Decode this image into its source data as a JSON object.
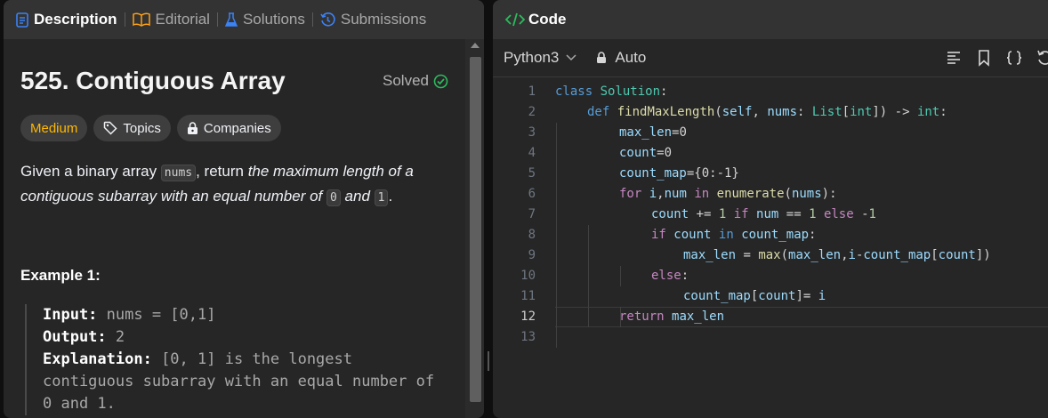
{
  "left_panel": {
    "tabs": [
      {
        "label": "Description",
        "icon": "document-icon"
      },
      {
        "label": "Editorial",
        "icon": "book-icon"
      },
      {
        "label": "Solutions",
        "icon": "flask-icon"
      },
      {
        "label": "Submissions",
        "icon": "history-icon"
      }
    ],
    "problem": {
      "title": "525. Contiguous Array",
      "status": "Solved",
      "difficulty": "Medium",
      "topics_label": "Topics",
      "companies_label": "Companies"
    },
    "description": {
      "prefix": "Given a binary array ",
      "code1": "nums",
      "mid": ", return ",
      "emph1": "the maximum length of a contiguous subarray with an equal number of ",
      "code2": "0",
      "and": " and ",
      "code3": "1",
      "end": "."
    },
    "example": {
      "title": "Example 1:",
      "input_label": "Input:",
      "input_value": " nums = [0,1]",
      "output_label": "Output:",
      "output_value": " 2",
      "explanation_label": "Explanation:",
      "explanation_line1": " [0, 1] is the longest",
      "explanation_line2": "contiguous subarray with an equal number of",
      "explanation_line3": "0 and 1."
    }
  },
  "right_panel": {
    "header_title": "Code",
    "language": "Python3",
    "mode": "Auto",
    "toolbar_icons": [
      "format-icon",
      "bookmark-icon",
      "braces-icon",
      "reset-icon"
    ],
    "current_line": 12,
    "code_lines": [
      {
        "n": "1",
        "indent": 0,
        "tokens": [
          [
            "kw2",
            "class"
          ],
          [
            "p",
            " "
          ],
          [
            "cls",
            "Solution"
          ],
          [
            "p",
            ":"
          ]
        ]
      },
      {
        "n": "2",
        "indent": 1,
        "tokens": [
          [
            "kw2",
            "def"
          ],
          [
            "p",
            " "
          ],
          [
            "fn",
            "findMaxLength"
          ],
          [
            "p",
            "("
          ],
          [
            "prm",
            "self"
          ],
          [
            "p",
            ", "
          ],
          [
            "prm",
            "nums"
          ],
          [
            "p",
            ": "
          ],
          [
            "cls",
            "List"
          ],
          [
            "p",
            "["
          ],
          [
            "cls",
            "int"
          ],
          [
            "p",
            "]) -> "
          ],
          [
            "cls",
            "int"
          ],
          [
            "p",
            ":"
          ]
        ]
      },
      {
        "n": "3",
        "indent": 2,
        "tokens": [
          [
            "prm",
            "max_len"
          ],
          [
            "p",
            "=0"
          ]
        ]
      },
      {
        "n": "4",
        "indent": 2,
        "tokens": [
          [
            "prm",
            "count"
          ],
          [
            "p",
            "=0"
          ]
        ]
      },
      {
        "n": "5",
        "indent": 2,
        "tokens": [
          [
            "prm",
            "count_map"
          ],
          [
            "p",
            "={0:-1}"
          ]
        ]
      },
      {
        "n": "6",
        "indent": 2,
        "tokens": [
          [
            "kw",
            "for"
          ],
          [
            "p",
            " "
          ],
          [
            "prm",
            "i"
          ],
          [
            "p",
            ","
          ],
          [
            "prm",
            "num"
          ],
          [
            "p",
            " "
          ],
          [
            "kw",
            "in"
          ],
          [
            "p",
            " "
          ],
          [
            "fn",
            "enumerate"
          ],
          [
            "p",
            "("
          ],
          [
            "prm",
            "nums"
          ],
          [
            "p",
            "):"
          ]
        ]
      },
      {
        "n": "7",
        "indent": 3,
        "tokens": [
          [
            "prm",
            "count"
          ],
          [
            "p",
            " += "
          ],
          [
            "num",
            "1"
          ],
          [
            "p",
            " "
          ],
          [
            "kw",
            "if"
          ],
          [
            "p",
            " "
          ],
          [
            "prm",
            "num"
          ],
          [
            "p",
            " == "
          ],
          [
            "num",
            "1"
          ],
          [
            "p",
            " "
          ],
          [
            "kw",
            "else"
          ],
          [
            "p",
            " -"
          ],
          [
            "num",
            "1"
          ]
        ]
      },
      {
        "n": "8",
        "indent": 3,
        "tokens": [
          [
            "kw",
            "if"
          ],
          [
            "p",
            " "
          ],
          [
            "prm",
            "count"
          ],
          [
            "p",
            " "
          ],
          [
            "kw2",
            "in"
          ],
          [
            "p",
            " "
          ],
          [
            "prm",
            "count_map"
          ],
          [
            "p",
            ":"
          ]
        ]
      },
      {
        "n": "9",
        "indent": 4,
        "tokens": [
          [
            "prm",
            "max_len"
          ],
          [
            "p",
            " = "
          ],
          [
            "fn",
            "max"
          ],
          [
            "p",
            "("
          ],
          [
            "prm",
            "max_len"
          ],
          [
            "p",
            ","
          ],
          [
            "prm",
            "i"
          ],
          [
            "p",
            "-"
          ],
          [
            "prm",
            "count_map"
          ],
          [
            "p",
            "["
          ],
          [
            "prm",
            "count"
          ],
          [
            "p",
            "])"
          ]
        ]
      },
      {
        "n": "10",
        "indent": 3,
        "tokens": [
          [
            "kw",
            "else"
          ],
          [
            "p",
            ":"
          ]
        ]
      },
      {
        "n": "11",
        "indent": 4,
        "tokens": [
          [
            "prm",
            "count_map"
          ],
          [
            "p",
            "["
          ],
          [
            "prm",
            "count"
          ],
          [
            "p",
            "]= "
          ],
          [
            "prm",
            "i"
          ]
        ]
      },
      {
        "n": "12",
        "indent": 2,
        "tokens": [
          [
            "kw",
            "return"
          ],
          [
            "p",
            " "
          ],
          [
            "prm",
            "max_len"
          ]
        ]
      },
      {
        "n": "13",
        "indent": 0,
        "tokens": []
      }
    ],
    "colors": {
      "keyword": "#c586c0",
      "builtin_keyword": "#569cd6",
      "type": "#4ec9b0",
      "function": "#dcdcaa",
      "variable": "#9cdcfe",
      "number": "#b5cea8"
    }
  }
}
